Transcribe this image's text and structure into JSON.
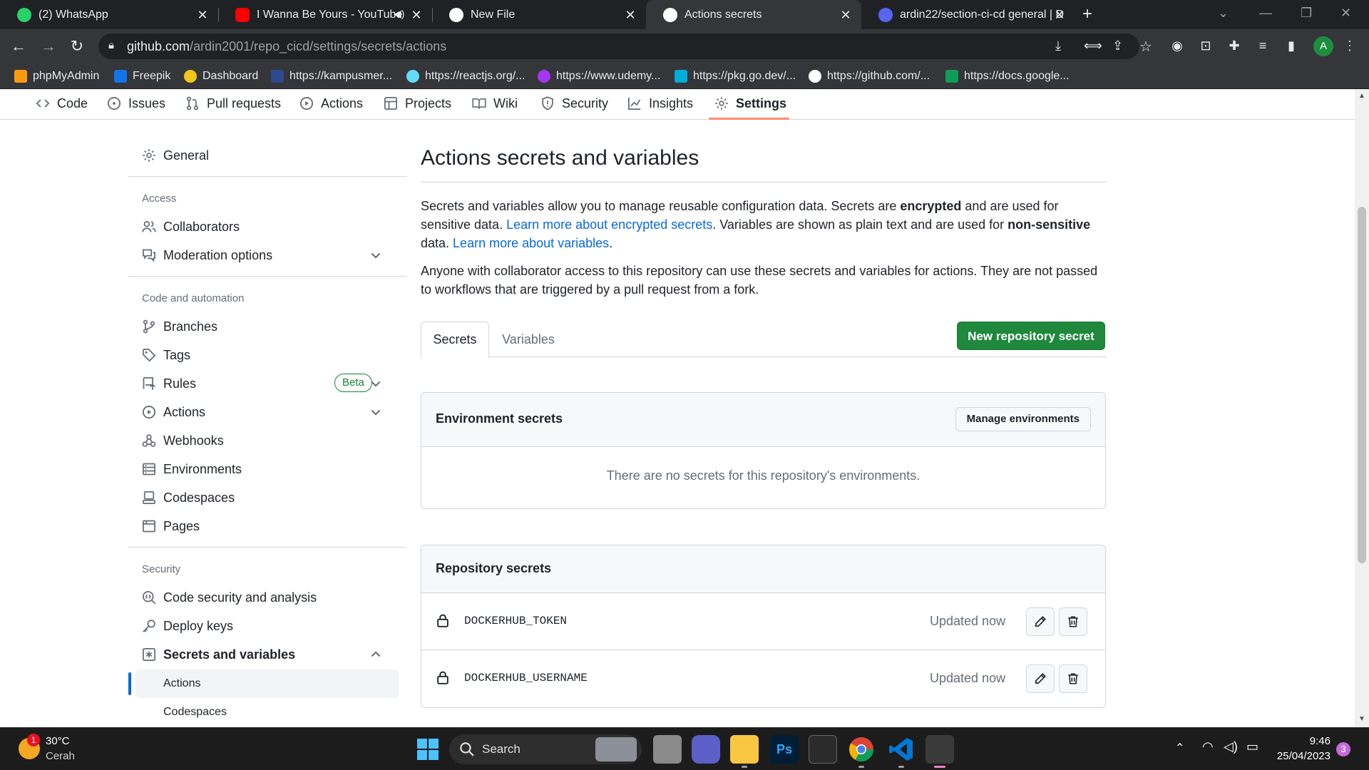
{
  "browser": {
    "tabs": [
      {
        "title": "(2) WhatsApp"
      },
      {
        "title": "I Wanna Be Yours - YouTube"
      },
      {
        "title": "New File"
      },
      {
        "title": "Actions secrets"
      },
      {
        "title": "ardin22/section-ci-cd general | D"
      }
    ],
    "url_host": "github.com",
    "url_path": "/ardin2001/repo_cicd/settings/secrets/actions",
    "profile_initial": "A",
    "bookmarks": [
      {
        "label": "phpMyAdmin"
      },
      {
        "label": "Freepik"
      },
      {
        "label": "Dashboard"
      },
      {
        "label": "https://kampusmer..."
      },
      {
        "label": "https://reactjs.org/..."
      },
      {
        "label": "https://www.udemy..."
      },
      {
        "label": "https://pkg.go.dev/..."
      },
      {
        "label": "https://github.com/..."
      },
      {
        "label": "https://docs.google..."
      }
    ]
  },
  "repo_nav": {
    "code": "Code",
    "issues": "Issues",
    "pull_requests": "Pull requests",
    "actions": "Actions",
    "projects": "Projects",
    "wiki": "Wiki",
    "security": "Security",
    "insights": "Insights",
    "settings": "Settings"
  },
  "sidebar": {
    "general": "General",
    "access_heading": "Access",
    "collaborators": "Collaborators",
    "moderation": "Moderation options",
    "code_automation_heading": "Code and automation",
    "branches": "Branches",
    "tags": "Tags",
    "rules": "Rules",
    "rules_badge": "Beta",
    "actions": "Actions",
    "webhooks": "Webhooks",
    "environments": "Environments",
    "codespaces": "Codespaces",
    "pages": "Pages",
    "security_heading": "Security",
    "code_security": "Code security and analysis",
    "deploy_keys": "Deploy keys",
    "secrets_variables": "Secrets and variables",
    "sub_actions": "Actions",
    "sub_codespaces": "Codespaces"
  },
  "main": {
    "title": "Actions secrets and variables",
    "p1_a": "Secrets and variables allow you to manage reusable configuration data. Secrets are ",
    "p1_b": "encrypted",
    "p1_c": " and are used for sensitive data. ",
    "p1_link1": "Learn more about encrypted secrets",
    "p1_d": ". Variables are shown as plain text and are used for ",
    "p1_e": "non-sensitive",
    "p1_f": " data. ",
    "p1_link2": "Learn more about variables",
    "p1_g": ".",
    "p2": "Anyone with collaborator access to this repository can use these secrets and variables for actions. They are not passed to workflows that are triggered by a pull request from a fork.",
    "tab_secrets": "Secrets",
    "tab_variables": "Variables",
    "new_secret_button": "New repository secret",
    "env_secrets_title": "Environment secrets",
    "manage_env_button": "Manage environments",
    "env_empty": "There are no secrets for this repository's environments.",
    "repo_secrets_title": "Repository secrets",
    "secrets": [
      {
        "name": "DOCKERHUB_TOKEN",
        "updated": "Updated now"
      },
      {
        "name": "DOCKERHUB_USERNAME",
        "updated": "Updated now"
      }
    ]
  },
  "taskbar": {
    "weather_temp": "30°C",
    "weather_desc": "Cerah",
    "weather_badge": "1",
    "search_label": "Search",
    "time": "9:46",
    "date": "25/04/2023",
    "notification_count": "3"
  },
  "colors": {
    "primary_button": "#1f883d",
    "link": "#0969da",
    "nav_underline": "#fd8c73"
  }
}
